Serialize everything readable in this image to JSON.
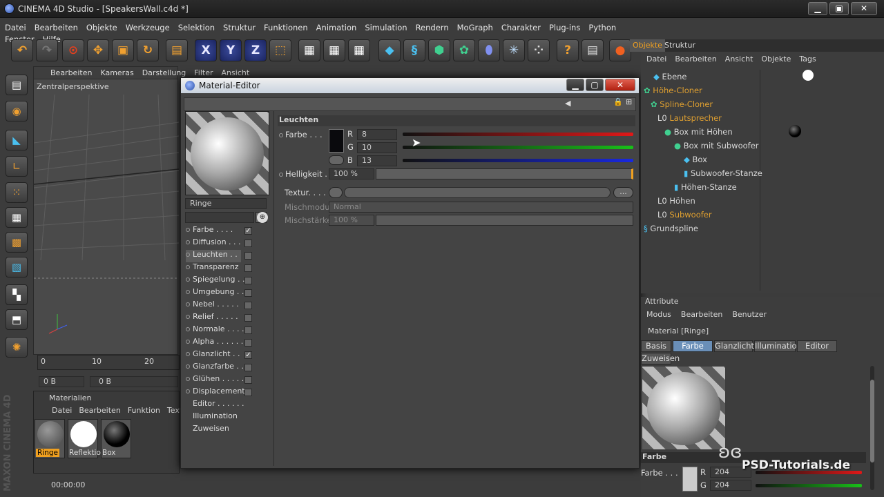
{
  "app": {
    "title": "CINEMA 4D Studio - [SpeakersWall.c4d *]"
  },
  "menu": [
    "Datei",
    "Bearbeiten",
    "Objekte",
    "Werkzeuge",
    "Selektion",
    "Struktur",
    "Funktionen",
    "Animation",
    "Simulation",
    "Rendern",
    "MoGraph",
    "Charakter",
    "Plug-ins",
    "Python",
    "Fenster",
    "Hilfe"
  ],
  "viewport": {
    "menu": [
      "Bearbeiten",
      "Kameras",
      "Darstellung",
      "Filter",
      "Ansicht"
    ],
    "label": "Zentralperspektive",
    "timeline": [
      "0",
      "10",
      "20"
    ],
    "frame_start": "0 B",
    "frame_cur": "0 B"
  },
  "materials": {
    "title": "Materialien",
    "menu": [
      "Datei",
      "Bearbeiten",
      "Funktion",
      "Textu"
    ],
    "items": [
      "Ringe",
      "Reflektio",
      "Box"
    ],
    "time": "00:00:00"
  },
  "material_editor": {
    "title": "Material-Editor",
    "material_name": "Ringe",
    "channels": [
      {
        "label": "Farbe . . . .",
        "checked": "✓"
      },
      {
        "label": "Diffusion . . .",
        "checked": ""
      },
      {
        "label": "Leuchten . .",
        "checked": ""
      },
      {
        "label": "Transparenz",
        "checked": ""
      },
      {
        "label": "Spiegelung . .",
        "checked": ""
      },
      {
        "label": "Umgebung . .",
        "checked": ""
      },
      {
        "label": "Nebel . . . . .",
        "checked": ""
      },
      {
        "label": "Relief . . . . .",
        "checked": ""
      },
      {
        "label": "Normale . . . .",
        "checked": ""
      },
      {
        "label": "Alpha . . . . . .",
        "checked": ""
      },
      {
        "label": "Glanzlicht . .",
        "checked": "✓"
      },
      {
        "label": "Glanzfarbe . .",
        "checked": ""
      },
      {
        "label": "Glühen . . . . .",
        "checked": ""
      },
      {
        "label": "Displacement",
        "checked": ""
      }
    ],
    "extras": [
      "Editor . . . . . .",
      "Illumination",
      "Zuweisen"
    ],
    "section": "Leuchten",
    "farbe_label": "Farbe . . .",
    "r_label": "R",
    "r": "8",
    "g_label": "G",
    "g": "10",
    "b_label": "B",
    "b": "13",
    "helligkeit_label": "Helligkeit . .",
    "helligkeit": "100 %",
    "textur_label": "Textur. . . . .",
    "textur_btn": "...",
    "mischmodus_label": "Mischmodus",
    "mischmodus": "Normal",
    "mischstaerke_label": "Mischstärke",
    "mischstaerke": "100 %"
  },
  "objects": {
    "tabs": [
      "Objekte",
      "Struktur"
    ],
    "menu": [
      "Datei",
      "Bearbeiten",
      "Ansicht",
      "Objekte",
      "Tags"
    ],
    "rows": [
      {
        "name": "Ebene",
        "color": "#d8d8d8"
      },
      {
        "name": "Höhe-Cloner",
        "color": "#e0a030"
      },
      {
        "name": "Spline-Cloner",
        "color": "#e0a030"
      },
      {
        "name": "Lautsprecher",
        "color": "#e0a030"
      },
      {
        "name": "Box mit Höhen",
        "color": "#d8d8d8"
      },
      {
        "name": "Box mit Subwoofer",
        "color": "#d8d8d8"
      },
      {
        "name": "Box",
        "color": "#d8d8d8"
      },
      {
        "name": "Subwoofer-Stanze",
        "color": "#d8d8d8"
      },
      {
        "name": "Höhen-Stanze",
        "color": "#d8d8d8"
      },
      {
        "name": "Höhen",
        "color": "#d8d8d8"
      },
      {
        "name": "Subwoofer",
        "color": "#e0a030"
      },
      {
        "name": "Grundspline",
        "color": "#d8d8d8"
      }
    ]
  },
  "attributes": {
    "title": "Attribute",
    "menu": [
      "Modus",
      "Bearbeiten",
      "Benutzer"
    ],
    "material": "Material [Ringe]",
    "tabs": [
      "Basis",
      "Farbe",
      "Glanzlicht",
      "Illumination",
      "Editor"
    ],
    "tab2": "Zuweisen",
    "section": "Farbe",
    "farbe_label": "Farbe . . .",
    "r_label": "R",
    "r": "204",
    "g_label": "G",
    "g": "204"
  },
  "watermark": "PSD-Tutorials.de",
  "brand": "MAXON CINEMA 4D"
}
